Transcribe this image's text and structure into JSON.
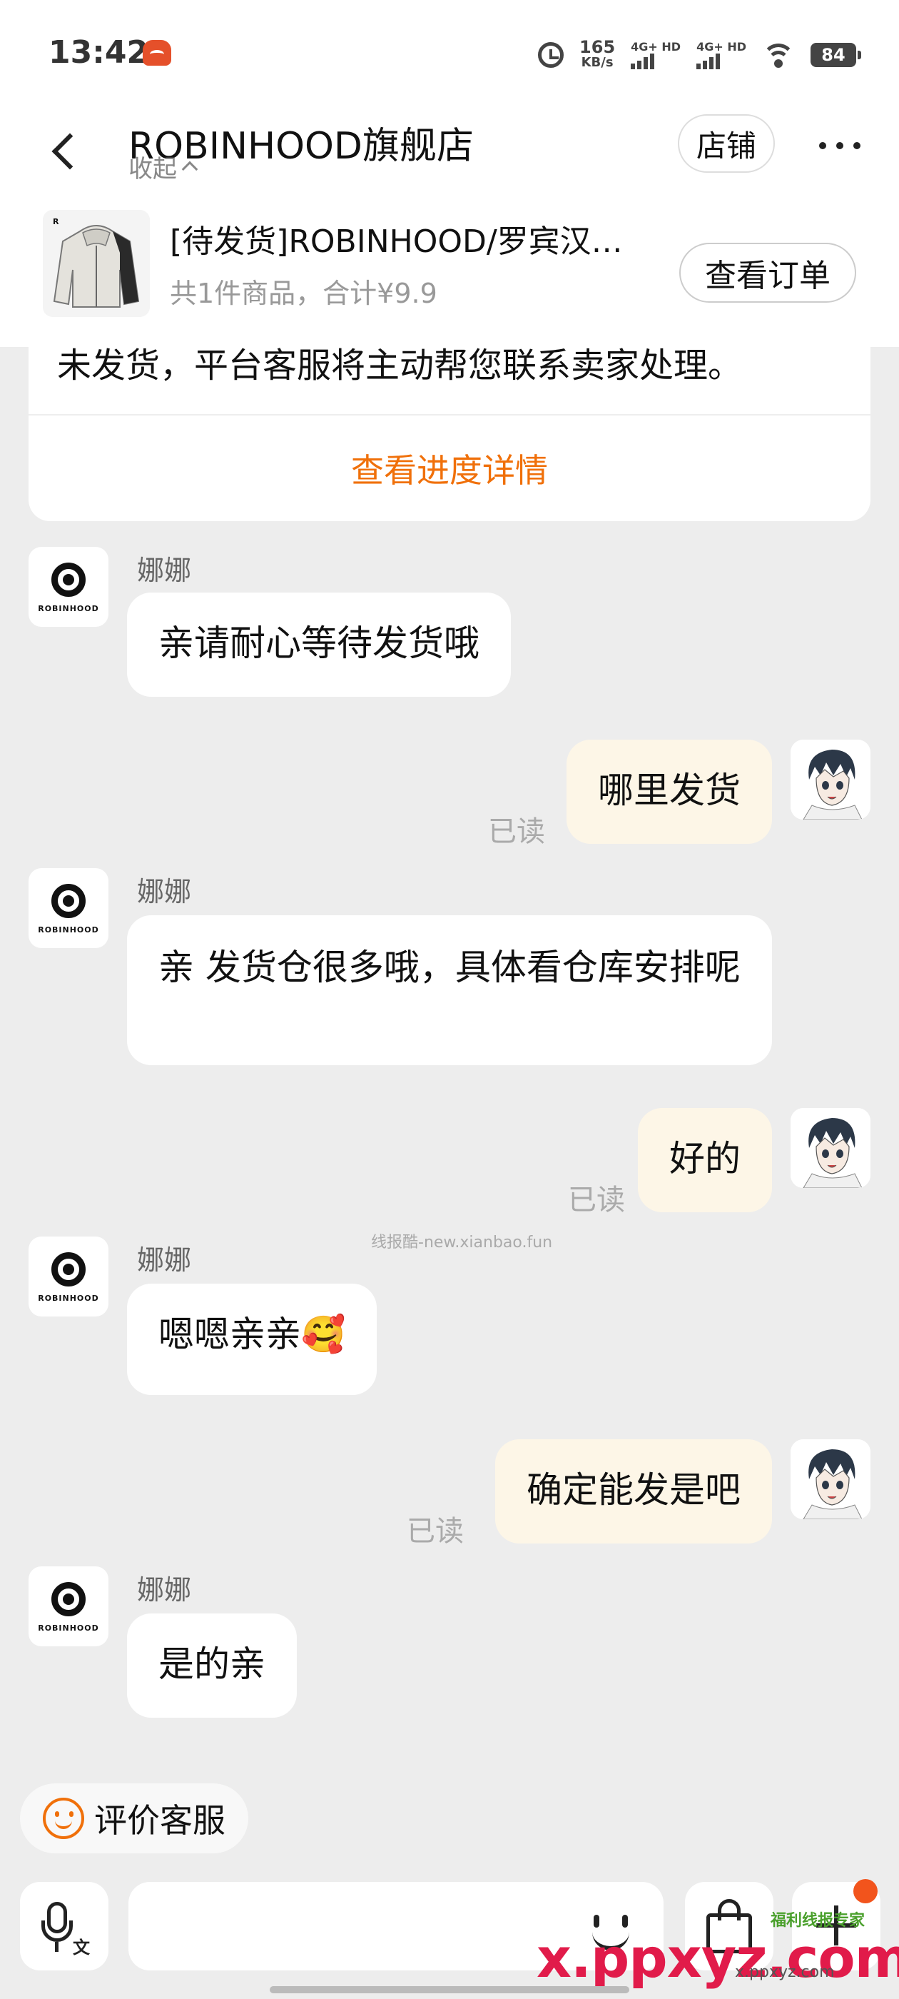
{
  "status_bar": {
    "time": "13:42",
    "net_speed_value": "165",
    "net_speed_unit": "KB/s",
    "sim1_label": "4G+ HD",
    "sim2_label": "4G+ HD",
    "battery": "84"
  },
  "header": {
    "title": "ROBINHOOD旗舰店",
    "collapse_label": "收起",
    "store_button": "店铺"
  },
  "order": {
    "title": "[待发货]ROBINHOOD/罗宾汉…",
    "summary": "共1件商品，合计¥9.9",
    "view_button": "查看订单"
  },
  "notice": {
    "text": "未发货，平台客服将主动帮您联系卖家处理。",
    "link": "查看进度详情"
  },
  "shop_avatar_word": "ROBINHOOD",
  "messages": [
    {
      "sender": "娜娜",
      "text": "亲请耐心等待发货哦"
    },
    {
      "text": "哪里发货",
      "read": "已读"
    },
    {
      "sender": "娜娜",
      "text": "亲 发货仓很多哦，具体看仓库安排呢"
    },
    {
      "text": "好的",
      "read": "已读"
    },
    {
      "sender": "娜娜",
      "text": "嗯嗯亲亲🥰"
    },
    {
      "text": "确定能发是吧",
      "read": "已读"
    },
    {
      "sender": "娜娜",
      "text": "是的亲"
    }
  ],
  "watermark_mid": "线报酷-new.xianbao.fun",
  "rate_button": "评价客服",
  "input": {
    "placeholder": "",
    "voice_badge": "文"
  },
  "watermarks": {
    "site": "x.ppxyz.com",
    "site_small": "x.ppxyz.com",
    "badge": "福利线报专家"
  },
  "colors": {
    "accent_orange": "#f0700a",
    "outgoing_bubble": "#fdf6e7",
    "background": "#ededed"
  },
  "icons": [
    "back-icon",
    "more-icon",
    "alarm-icon",
    "wifi-icon",
    "smile-icon",
    "mic-icon",
    "emoji-icon",
    "bag-icon",
    "plus-icon"
  ]
}
